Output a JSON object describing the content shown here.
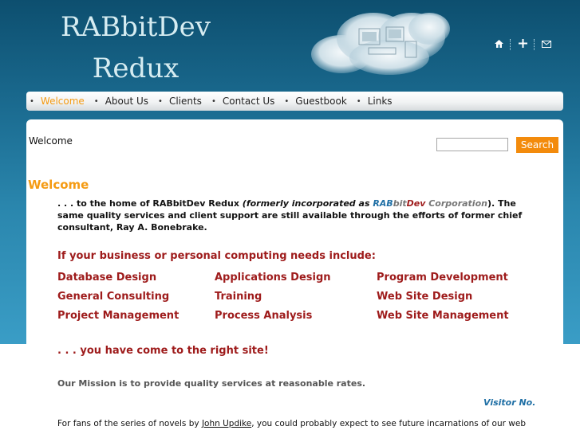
{
  "site": {
    "title_line1": "RABbitDev",
    "title_line2": "Redux"
  },
  "top_icons": [
    "home-icon",
    "sitemap-icon",
    "mail-icon"
  ],
  "nav": {
    "items": [
      {
        "label": "Welcome"
      },
      {
        "label": "About Us"
      },
      {
        "label": "Clients"
      },
      {
        "label": "Contact Us"
      },
      {
        "label": "Guestbook"
      },
      {
        "label": "Links"
      }
    ]
  },
  "breadcrumb": "Welcome",
  "search": {
    "value": "",
    "button_label": "Search"
  },
  "main": {
    "heading": "Welcome",
    "intro_pre": ". . . to the home of RABbitDev Redux ",
    "intro_formerly": "(formerly incorporated as ",
    "intro_rab": "RAB",
    "intro_bit": "bit",
    "intro_dev": "Dev",
    "intro_corp": " Corporation",
    "intro_close": ").",
    "intro_post": "  The same quality services and client support are still available through the efforts of former chief consultant, Ray A. Bonebrake.",
    "needs_heading": "If your business or personal computing needs include:",
    "services": [
      "Database Design",
      "Applications Design",
      "Program Development",
      "General Consulting",
      "Training",
      "Web Site Design",
      "Project Management",
      "Process Analysis",
      "Web Site Management"
    ],
    "right_site": ". . . you have come to the right site!",
    "mission": "Our Mission is to provide quality services at reasonable rates.",
    "visitor_label": "Visitor No.",
    "fans_pre": "For fans of the series of novels by ",
    "fans_link": "John Updike",
    "fans_post": ", you could probably expect to see future incarnations of our web"
  },
  "colors": {
    "accent_orange": "#f59b13",
    "service_red": "#9e1b1b",
    "link_blue": "#1f6fa5",
    "header_blue": "#0d4f6f"
  }
}
